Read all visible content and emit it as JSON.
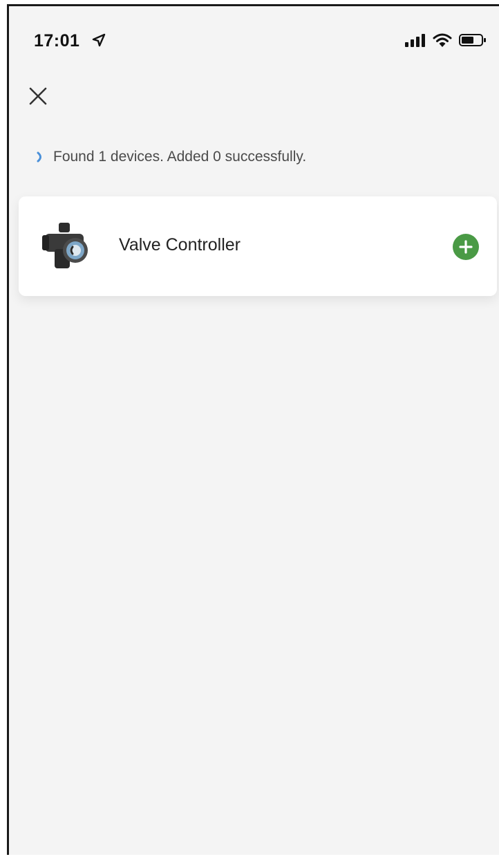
{
  "status_bar": {
    "time": "17:01",
    "icons": [
      "location-arrow-icon",
      "cellular-signal-icon",
      "wifi-icon",
      "battery-icon"
    ]
  },
  "header": {
    "close_icon": "close-icon"
  },
  "scan": {
    "progress_text": "Found 1 devices. Added 0 successfully.",
    "spinner_color": "#4a90d9"
  },
  "devices": [
    {
      "name": "Valve Controller",
      "icon": "valve-controller-image",
      "action_icon": "add-circle-icon",
      "action_color": "#4a9a45"
    }
  ]
}
